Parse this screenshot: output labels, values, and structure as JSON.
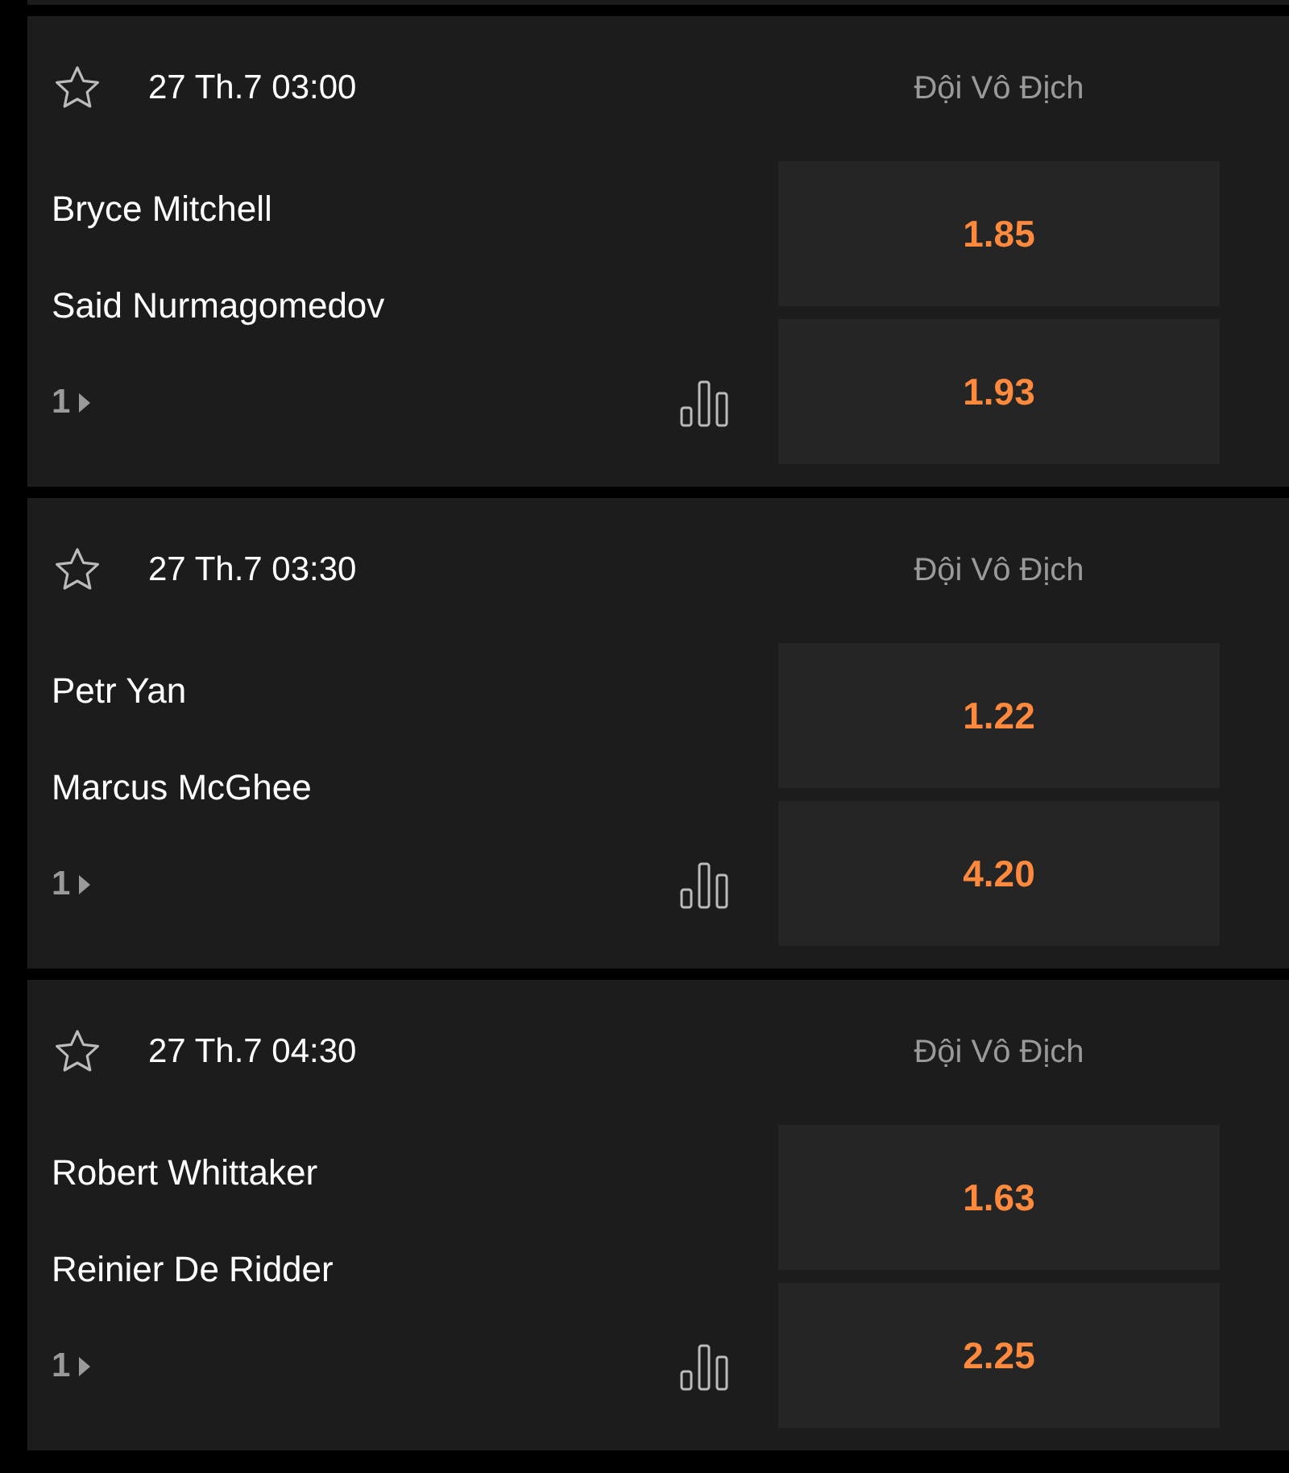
{
  "matches": [
    {
      "starred": false,
      "time": "27 Th.7 03:00",
      "market": "Đội Vô Địch",
      "competitors": [
        "Bryce Mitchell",
        "Said Nurmagomedov"
      ],
      "more_markets": "1",
      "odds": [
        "1.85",
        "1.93"
      ]
    },
    {
      "starred": false,
      "time": "27 Th.7 03:30",
      "market": "Đội Vô Địch",
      "competitors": [
        "Petr Yan",
        "Marcus McGhee"
      ],
      "more_markets": "1",
      "odds": [
        "1.22",
        "4.20"
      ]
    },
    {
      "starred": false,
      "time": "27 Th.7 04:30",
      "market": "Đội Vô Địch",
      "competitors": [
        "Robert Whittaker",
        "Reinier De Ridder"
      ],
      "more_markets": "1",
      "odds": [
        "1.63",
        "2.25"
      ]
    }
  ]
}
